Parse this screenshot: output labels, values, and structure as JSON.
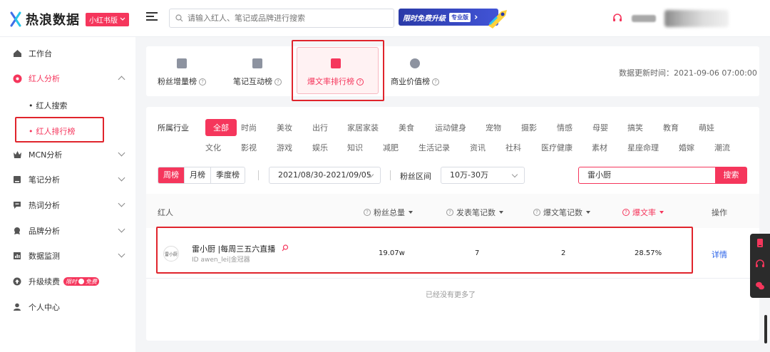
{
  "header": {
    "logo_text": "热浪数据",
    "version_label": "小红书版",
    "search_placeholder": "请输入红人、笔记或品牌进行搜索",
    "promo_text": "限时免费升级",
    "promo_badge": "专业版"
  },
  "sidebar": {
    "items": [
      {
        "label": "工作台"
      },
      {
        "label": "红人分析"
      },
      {
        "label": "MCN分析"
      },
      {
        "label": "笔记分析"
      },
      {
        "label": "热词分析"
      },
      {
        "label": "品牌分析"
      },
      {
        "label": "数据监测"
      },
      {
        "label": "升级续费"
      },
      {
        "label": "个人中心"
      }
    ],
    "sub_items": [
      {
        "label": "红人搜索"
      },
      {
        "label": "红人排行榜"
      }
    ],
    "upgrade_badge": "限时",
    "upgrade_badge2": "免费"
  },
  "rank_tabs": [
    {
      "label": "粉丝增量榜"
    },
    {
      "label": "笔记互动榜"
    },
    {
      "label": "爆文率排行榜"
    },
    {
      "label": "商业价值榜"
    }
  ],
  "update_time": "数据更新时间：2021-09-06 07:00:00",
  "filters": {
    "industry_label": "所属行业",
    "industries_row1": [
      "全部",
      "时尚",
      "美妆",
      "出行",
      "家居家装",
      "美食",
      "运动健身",
      "宠物",
      "摄影",
      "情感",
      "母婴",
      "搞笑",
      "教育",
      "萌娃"
    ],
    "industries_row2": [
      "文化",
      "影视",
      "游戏",
      "娱乐",
      "知识",
      "减肥",
      "生活记录",
      "资讯",
      "社科",
      "医疗健康",
      "素材",
      "星座命理",
      "婚嫁",
      "潮流"
    ],
    "periods": [
      "周榜",
      "月榜",
      "季度榜"
    ],
    "date_range": "2021/08/30-2021/09/05",
    "fans_range_label": "粉丝区间",
    "fans_range": "10万-30万",
    "keyword": "雷小厨",
    "search_button": "搜索"
  },
  "table": {
    "columns": [
      "红人",
      "粉丝总量",
      "发表笔记数",
      "爆文笔记数",
      "爆文率",
      "操作"
    ],
    "rows": [
      {
        "name": "雷小厨 |每周三五六直播",
        "id": "ID awen_lei|金冠器",
        "avatar_text": "雷小厨",
        "fans": "19.07w",
        "notes": "7",
        "hot_notes": "2",
        "hot_rate": "28.57%",
        "action": "详情"
      }
    ],
    "footer": "已经没有更多了"
  },
  "colors": {
    "accent": "#f5365c",
    "link": "#2b63e8",
    "highlight_box": "#e0242c"
  }
}
